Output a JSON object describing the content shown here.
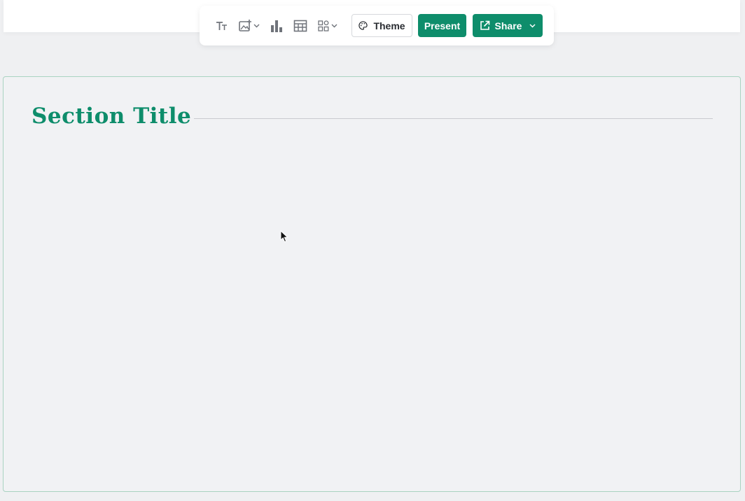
{
  "toolbar": {
    "icons": [
      {
        "name": "text-icon"
      },
      {
        "name": "image-add-icon"
      },
      {
        "name": "bar-chart-icon"
      },
      {
        "name": "table-icon"
      },
      {
        "name": "elements-icon"
      }
    ],
    "theme_label": "Theme",
    "present_label": "Present",
    "share_label": "Share"
  },
  "slide": {
    "section_title": "Section Title"
  },
  "colors": {
    "accent": "#0e8d6b",
    "card_border": "#a9d3c1",
    "background": "#eff0f2"
  }
}
